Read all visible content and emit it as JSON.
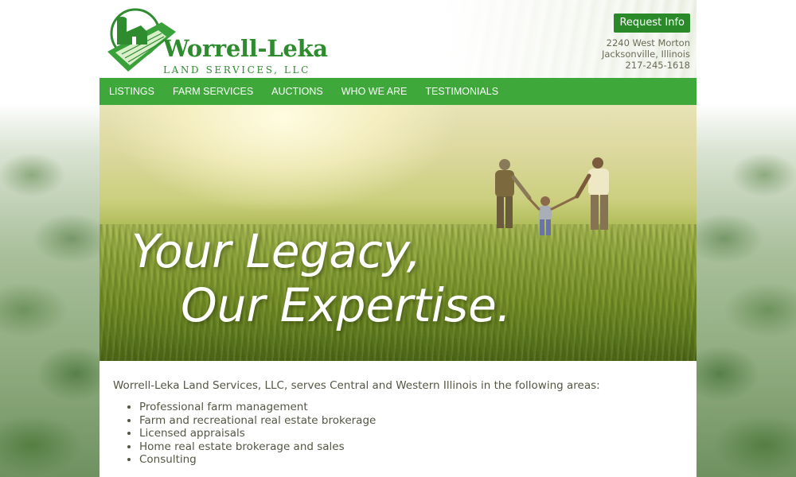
{
  "brand": {
    "name": "Worrell-Leka",
    "subtitle": "LAND SERVICES, LLC"
  },
  "header": {
    "request_button": "Request Info",
    "address_line1": "2240 West Morton",
    "address_line2": "Jacksonville, Illinois",
    "phone": "217-245-1618"
  },
  "nav": {
    "items": [
      {
        "label": "LISTINGS"
      },
      {
        "label": "FARM SERVICES"
      },
      {
        "label": "AUCTIONS"
      },
      {
        "label": "WHO WE ARE"
      },
      {
        "label": "TESTIMONIALS"
      }
    ]
  },
  "hero": {
    "line1": "Your Legacy,",
    "line2": "Our Expertise."
  },
  "content": {
    "intro": "Worrell-Leka Land Services, LLC, serves Central and Western Illinois in the following areas:",
    "services": [
      "Professional farm management",
      "Farm and recreational real estate brokerage",
      "Licensed appraisals",
      "Home real estate brokerage and sales",
      "Consulting"
    ]
  },
  "colors": {
    "brand_green": "#2e8b2e",
    "nav_green": "#3ea83a",
    "button_green": "#2a8a2a",
    "body_text": "#555544"
  }
}
